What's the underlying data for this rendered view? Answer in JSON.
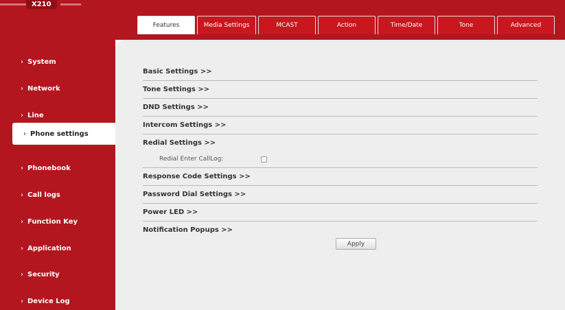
{
  "header": {
    "brand": "X210"
  },
  "sidebar": {
    "items": [
      {
        "label": "System"
      },
      {
        "label": "Network"
      },
      {
        "label": "Line"
      },
      {
        "label": "Phone settings",
        "active": true
      },
      {
        "label": "Phonebook"
      },
      {
        "label": "Call logs"
      },
      {
        "label": "Function Key"
      },
      {
        "label": "Application"
      },
      {
        "label": "Security"
      },
      {
        "label": "Device Log"
      }
    ]
  },
  "tabs": [
    {
      "label": "Features",
      "active": true
    },
    {
      "label": "Media Settings"
    },
    {
      "label": "MCAST"
    },
    {
      "label": "Action"
    },
    {
      "label": "Time/Date"
    },
    {
      "label": "Tone"
    },
    {
      "label": "Advanced"
    }
  ],
  "sections": {
    "basic": "Basic Settings >>",
    "tone": "Tone Settings >>",
    "dnd": "DND Settings >>",
    "intercom": "Intercom Settings >>",
    "redial": "Redial Settings >>",
    "response_code": "Response Code Settings >>",
    "password_dial": "Password Dial Settings >>",
    "power_led": "Power LED >>",
    "notification": "Notification Popups >>"
  },
  "redial": {
    "enter_calllog_label": "Redial Enter CallLog:",
    "enter_calllog_checked": false
  },
  "apply_label": "Apply",
  "colors": {
    "brand_red": "#b3161f",
    "tab_red": "#c8171f",
    "panel_bg": "#eeeeef"
  }
}
